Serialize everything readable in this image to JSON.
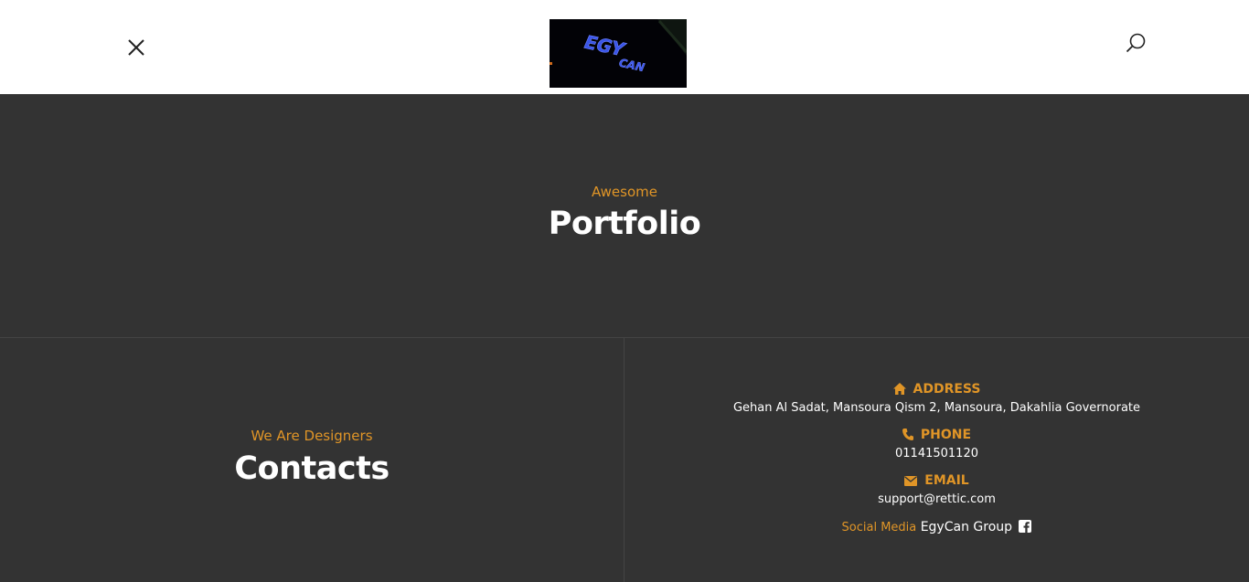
{
  "header": {
    "logo_text": "EGYCAN"
  },
  "portfolio": {
    "subtitle": "Awesome",
    "title": "Portfolio"
  },
  "contacts": {
    "subtitle": "We Are Designers",
    "title": "Contacts"
  },
  "info": {
    "address_label": "ADDRESS",
    "address_value": "Gehan Al Sadat, Mansoura Qism 2, Mansoura, Dakahlia Governorate",
    "phone_label": "PHONE",
    "phone_value": "01141501120",
    "email_label": "EMAIL",
    "email_value": "support@rettic.com",
    "social_label": "Social Media",
    "social_value": "EgyCan Group"
  },
  "colors": {
    "accent": "#e09527",
    "background": "#333333",
    "header": "#ffffff"
  },
  "icons": [
    "close-icon",
    "search-icon",
    "home-icon",
    "phone-icon",
    "envelope-icon",
    "facebook-icon"
  ]
}
